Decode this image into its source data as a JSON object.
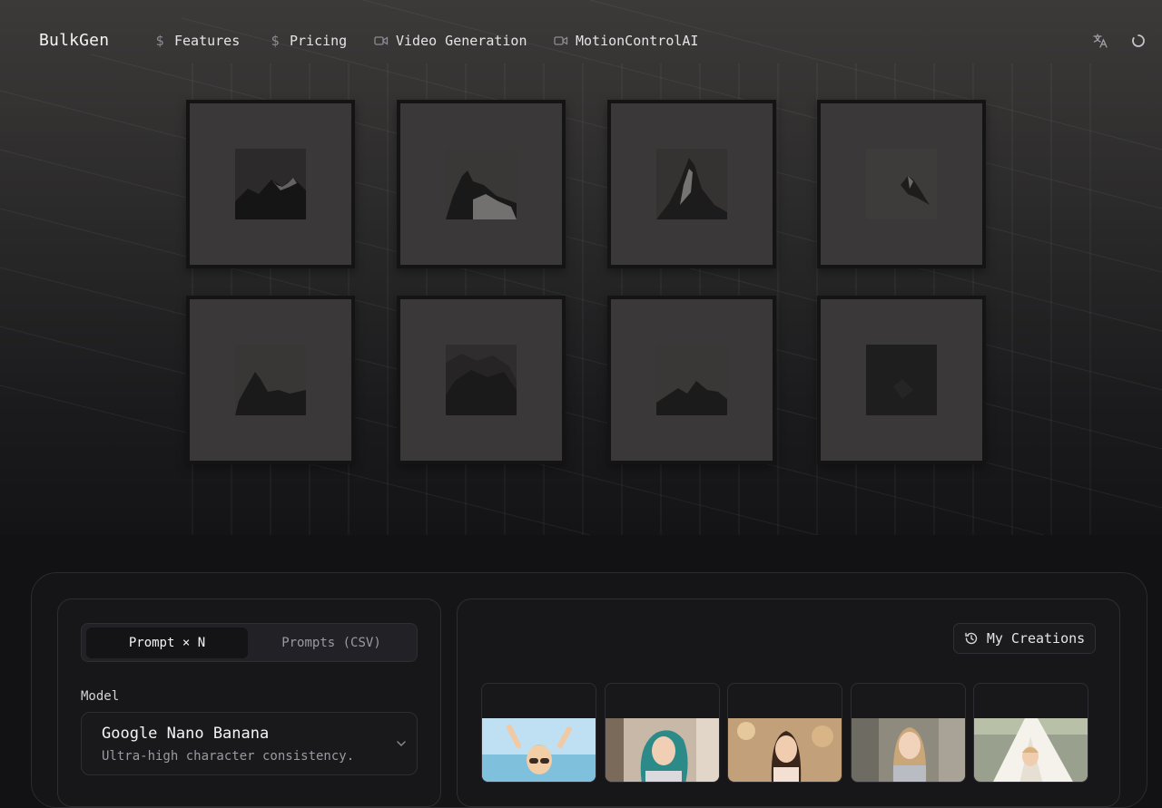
{
  "nav": {
    "brand": "BulkGen",
    "items": [
      {
        "label": "Features",
        "icon": "dollar-icon"
      },
      {
        "label": "Pricing",
        "icon": "dollar-icon"
      },
      {
        "label": "Video Generation",
        "icon": "video-camera-icon"
      },
      {
        "label": "MotionControlAI",
        "icon": "video-camera-icon"
      }
    ],
    "right_icons": [
      "translate-icon",
      "loading-spinner-icon"
    ]
  },
  "hero": {
    "gallery_frames": [
      {
        "icon": "mountain-photo"
      },
      {
        "icon": "mountain-photo"
      },
      {
        "icon": "mountain-photo"
      },
      {
        "icon": "mountain-photo"
      },
      {
        "icon": "mountain-photo"
      },
      {
        "icon": "mountain-photo"
      },
      {
        "icon": "mountain-photo"
      },
      {
        "icon": "dark-photo"
      }
    ]
  },
  "generator": {
    "modes": [
      {
        "label": "Prompt × N",
        "active": true
      },
      {
        "label": "Prompts (CSV)",
        "active": false
      }
    ],
    "model": {
      "label": "Model",
      "selected_name": "Google Nano Banana",
      "selected_description": "Ultra-high character consistency."
    }
  },
  "results": {
    "my_creations_label": "My Creations",
    "thumbnails": [
      {
        "subject": "child-at-beach-photo"
      },
      {
        "subject": "girl-with-teal-hair-photo"
      },
      {
        "subject": "girl-outdoors-photo"
      },
      {
        "subject": "girl-in-sweater-photo"
      },
      {
        "subject": "child-in-tent-photo"
      }
    ]
  },
  "colors": {
    "background": "#121214",
    "panel": "#17171a",
    "border": "#2d2d33",
    "text": "#e4e4e7",
    "muted_text": "#9a9aa2"
  }
}
